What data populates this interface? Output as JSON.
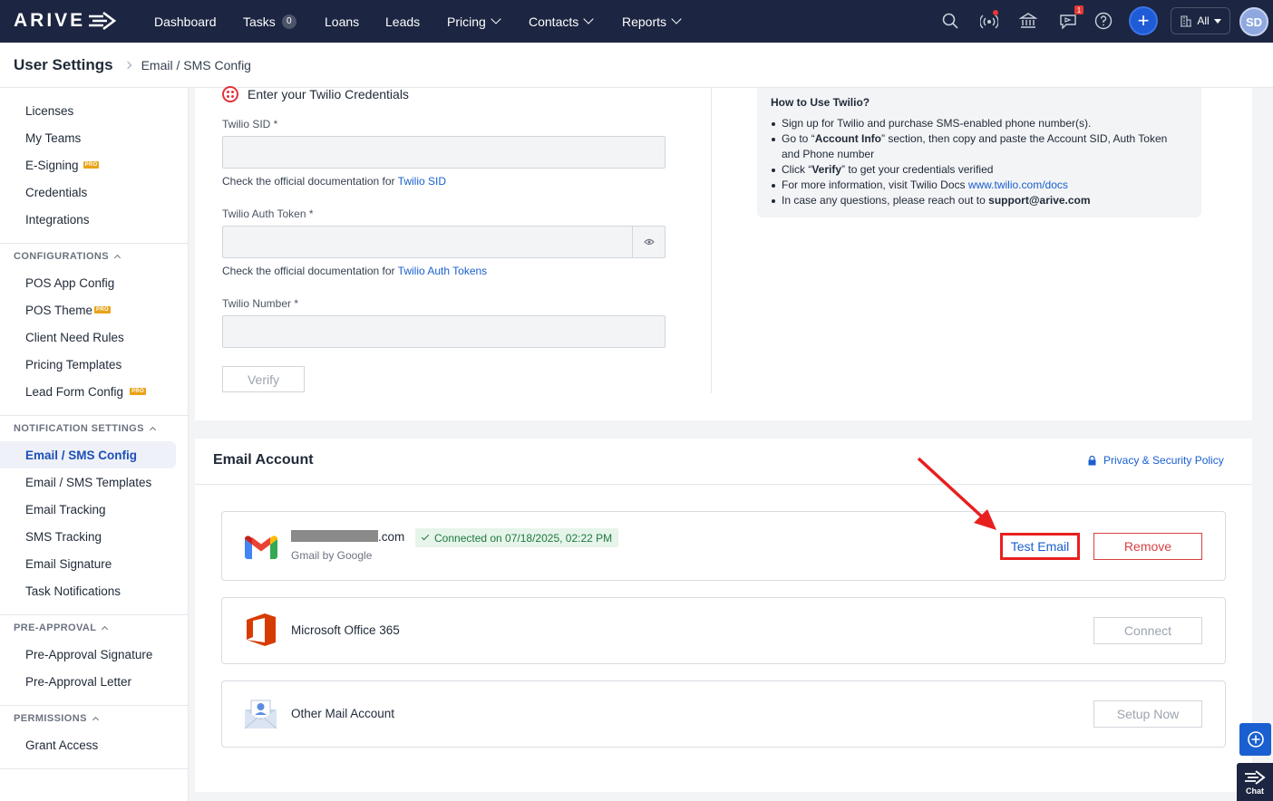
{
  "brand": {
    "logo_text": "ARIVE"
  },
  "nav": {
    "dashboard": "Dashboard",
    "tasks": "Tasks",
    "tasks_count": "0",
    "loans": "Loans",
    "leads": "Leads",
    "pricing": "Pricing",
    "contacts": "Contacts",
    "reports": "Reports",
    "campaign_badge": "1",
    "scope_select": "All",
    "avatar_initials": "SD"
  },
  "header": {
    "title": "User Settings",
    "breadcrumb": "Email / SMS Config"
  },
  "sidebar": {
    "top_items": [
      "Licenses",
      "My Teams",
      "E-Signing",
      "Credentials",
      "Integrations"
    ],
    "pro_label": "PRO",
    "sections": {
      "configurations": "CONFIGURATIONS",
      "notification_settings": "NOTIFICATION SETTINGS",
      "pre_approval": "PRE-APPROVAL",
      "permissions": "PERMISSIONS"
    },
    "config_items": [
      "POS App Config",
      "POS Theme",
      "Client Need Rules",
      "Pricing Templates",
      "Lead Form Config"
    ],
    "notification_items": [
      "Email / SMS Config",
      "Email / SMS Templates",
      "Email Tracking",
      "SMS Tracking",
      "Email Signature",
      "Task Notifications"
    ],
    "pre_approval_items": [
      "Pre-Approval Signature",
      "Pre-Approval Letter"
    ],
    "permission_items": [
      "Grant Access"
    ]
  },
  "twilio": {
    "heading": "Enter your Twilio Credentials",
    "sid_label": "Twilio SID *",
    "sid_value": "",
    "sid_help": "Check the official documentation for ",
    "sid_help_link": "Twilio SID",
    "token_label": "Twilio Auth Token *",
    "token_value": "",
    "token_help": "Check the official documentation for ",
    "token_help_link": "Twilio Auth Tokens",
    "number_label": "Twilio Number *",
    "number_value": "",
    "verify_label": "Verify"
  },
  "howto": {
    "title": "How to Use Twilio?",
    "line1": "Sign up for Twilio and purchase SMS-enabled phone number(s).",
    "line2_a": "Go to “",
    "line2_b": "Account Info",
    "line2_c": "” section, then copy and paste the Account SID, Auth Token and Phone number",
    "line3_a": "Click “",
    "line3_b": "Verify",
    "line3_c": "” to get your credentials verified",
    "line4_a": "For more information, visit Twilio Docs ",
    "line4_link": "www.twilio.com/docs",
    "line5_a": "In case any questions, please reach out to ",
    "line5_b": "support@arive.com"
  },
  "email_account": {
    "title": "Email Account",
    "privacy_link": "Privacy & Security Policy",
    "gmail": {
      "address_suffix": ".com",
      "provider": "Gmail by Google",
      "status": "Connected on 07/18/2025, 02:22 PM",
      "test_label": "Test Email",
      "remove_label": "Remove"
    },
    "office": {
      "name": "Microsoft Office 365",
      "action": "Connect"
    },
    "other": {
      "name": "Other Mail Account",
      "action": "Setup Now"
    }
  },
  "widgets": {
    "chat_label": "Chat"
  },
  "colors": {
    "nav_bg": "#1c2541",
    "accent": "#1a5fd0",
    "danger": "#d94040",
    "annotation": "#e81f1f",
    "success": "#1e7a3c"
  }
}
